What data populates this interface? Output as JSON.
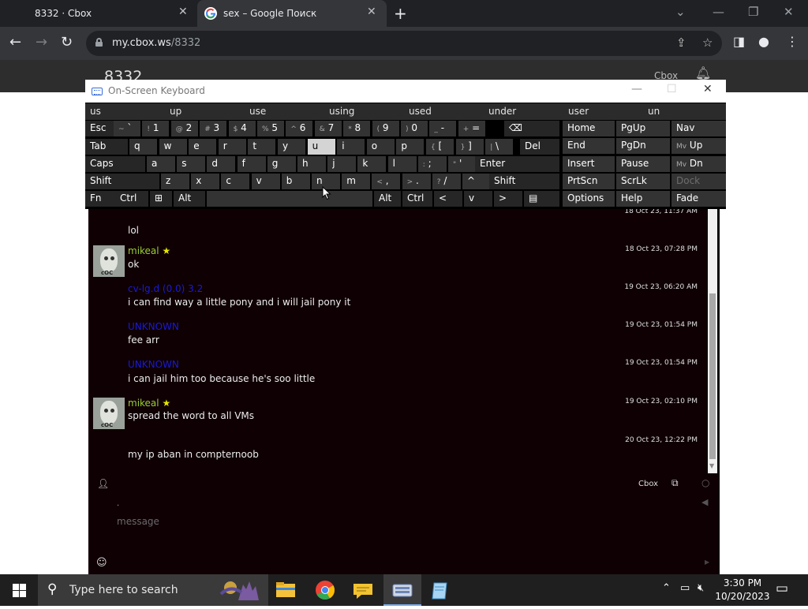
{
  "browser": {
    "tabs": [
      {
        "title": "8332 · Cbox",
        "active": false
      },
      {
        "title": "sex – Google Поиск",
        "active": true
      }
    ],
    "url_host": "my.cbox.ws",
    "url_path": "/8332"
  },
  "page": {
    "room_name": "8332",
    "header_right": "Cbox"
  },
  "chat": {
    "messages": [
      {
        "name": "",
        "text": "lol",
        "time": "18 Oct 23, 11:37 AM"
      },
      {
        "name": "mikeal",
        "star": true,
        "text": "ok",
        "time": "18 Oct 23, 07:28 PM"
      },
      {
        "name": "cv-lg.d (0.0) 3.2",
        "text": "i can find way a little pony and i will jail pony it",
        "time": "19 Oct 23, 06:20 AM"
      },
      {
        "name": "UNKNOWN",
        "text": "fee arr",
        "time": "19 Oct 23, 01:54 PM"
      },
      {
        "name": "UNKNOWN",
        "text": "i can jail him too because he's soo little",
        "time": "19 Oct 23, 01:54 PM"
      },
      {
        "name": "mikeal",
        "star": true,
        "text": "spread the word to all VMs",
        "time": "19 Oct 23, 02:10 PM"
      },
      {
        "name": "",
        "text": "my ip aban in compternoob",
        "time": "20 Oct 23, 12:22 PM"
      }
    ],
    "user_name": ".",
    "input_placeholder": "message",
    "footer_brand": "Cbox"
  },
  "osk": {
    "title": "On-Screen Keyboard",
    "predictions": [
      "us",
      "up",
      "use",
      "using",
      "used",
      "under",
      "user",
      "un"
    ],
    "row1": [
      "Esc",
      "~ `",
      "! 1",
      "@ 2",
      "# 3",
      "$ 4",
      "% 5",
      "^ 6",
      "& 7",
      "* 8",
      "( 9",
      ") 0",
      "_ -",
      "+ =",
      "⌫"
    ],
    "row2": [
      "Tab",
      "q",
      "w",
      "e",
      "r",
      "t",
      "y",
      "u",
      "i",
      "o",
      "p",
      "{ [",
      "} ]",
      "| \\",
      "Del"
    ],
    "row3": [
      "Caps",
      "a",
      "s",
      "d",
      "f",
      "g",
      "h",
      "j",
      "k",
      "l",
      ": ;",
      "\" '",
      "Enter"
    ],
    "row4": [
      "Shift",
      "z",
      "x",
      "c",
      "v",
      "b",
      "n",
      "m",
      "< ,",
      "> .",
      "? /",
      "^",
      "Shift"
    ],
    "row5": [
      "Fn",
      "Ctrl",
      "⊞",
      "Alt",
      "Alt",
      "Ctrl",
      "<",
      "v",
      ">",
      "▤"
    ],
    "nav": [
      "Home",
      "PgUp",
      "Nav",
      "End",
      "PgDn",
      "Mv Up",
      "Insert",
      "Pause",
      "Mv Dn",
      "PrtScn",
      "ScrLk",
      "Dock",
      "Options",
      "Help",
      "Fade"
    ]
  },
  "taskbar": {
    "search_placeholder": "Type here to search",
    "time": "3:30 PM",
    "date": "10/20/2023"
  },
  "colors": {
    "chat_bg": "#0f0004",
    "name_green": "#9acd32",
    "name_blue": "#1a1ad4",
    "osk_key": "#333333"
  }
}
